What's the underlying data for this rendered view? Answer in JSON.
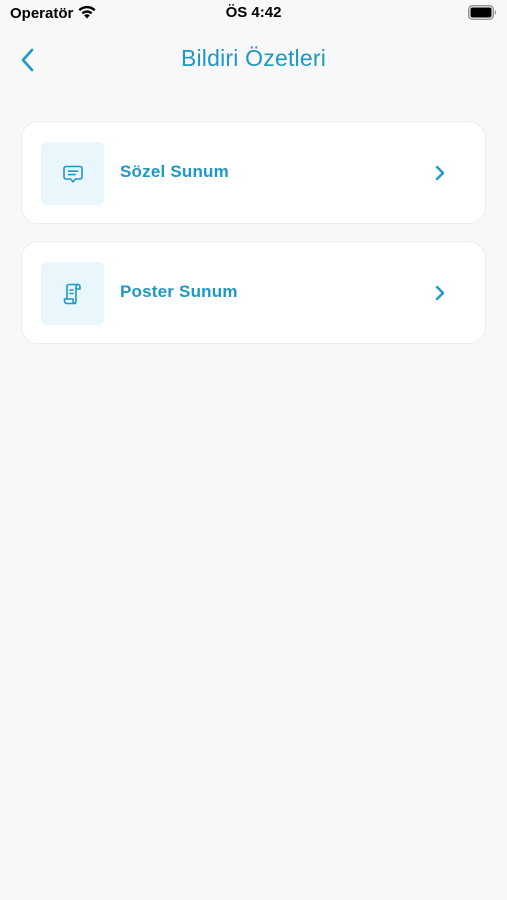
{
  "status_bar": {
    "carrier": "Operatör",
    "time": "ÖS 4:42"
  },
  "header": {
    "title": "Bildiri Özetleri",
    "back_icon": "chevron-left-icon"
  },
  "menu": {
    "items": [
      {
        "label": "Sözel Sunum",
        "icon": "message-icon"
      },
      {
        "label": "Poster Sunum",
        "icon": "scroll-icon"
      }
    ]
  },
  "colors": {
    "accent": "#1e98c7",
    "icon_background": "#e9f6fc",
    "page_background": "#f8f8f8"
  }
}
